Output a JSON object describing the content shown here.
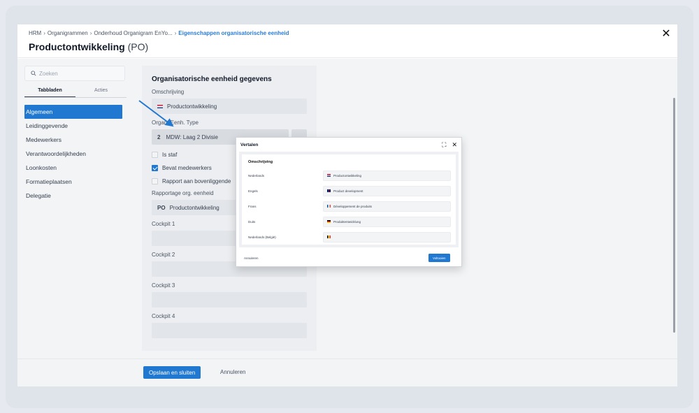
{
  "breadcrumb": {
    "items": [
      "HRM",
      "Organigrammen",
      "Onderhoud Organigram EnYo..."
    ],
    "separator": "›",
    "current": "Eigenschappen organisatorische eenheid"
  },
  "page": {
    "title": "Productontwikkeling",
    "code": "(PO)",
    "close_glyph": "✕"
  },
  "sidebar": {
    "search_placeholder": "Zoeken",
    "tabs": [
      {
        "label": "Tabbladen",
        "active": true
      },
      {
        "label": "Acties",
        "active": false
      }
    ],
    "items": [
      {
        "label": "Algemeen",
        "active": true
      },
      {
        "label": "Leidinggevende",
        "active": false
      },
      {
        "label": "Medewerkers",
        "active": false
      },
      {
        "label": "Verantwoordelijkheden",
        "active": false
      },
      {
        "label": "Loonkosten",
        "active": false
      },
      {
        "label": "Formatieplaatsen",
        "active": false
      },
      {
        "label": "Delegatie",
        "active": false
      }
    ]
  },
  "form": {
    "section_title": "Organisatorische eenheid gegevens",
    "omschrijving_label": "Omschrijving",
    "omschrijving_value": "Productontwikkeling",
    "type_label": "Organ. Eenh. Type",
    "type_code": "2",
    "type_value": "MDW: Laag 2 Divisie",
    "checks": [
      {
        "label": "Is staf",
        "checked": false
      },
      {
        "label": "Bevat medewerkers",
        "checked": true
      },
      {
        "label": "Rapport aan bovenliggende",
        "checked": false
      }
    ],
    "rapportage_label": "Rapportage org. eenheid",
    "rapportage_code": "PO",
    "rapportage_value": "Productontwikkeling",
    "cockpits": [
      "Cockpit 1",
      "Cockpit 2",
      "Cockpit 3",
      "Cockpit 4"
    ]
  },
  "footer": {
    "save_label": "Opslaan en sluiten",
    "cancel_label": "Annuleren"
  },
  "modal": {
    "title": "Vertalen",
    "expand_glyph": "⛶",
    "close_glyph": "✕",
    "section_title": "Omschrijving",
    "rows": [
      {
        "lang": "Nederlands",
        "flag": "nl",
        "value": "Productontwikkeling"
      },
      {
        "lang": "Engels",
        "flag": "gb",
        "value": "Product development"
      },
      {
        "lang": "Frans",
        "flag": "fr",
        "value": "Développement de produits"
      },
      {
        "lang": "Duits",
        "flag": "de",
        "value": "Produktentwicklung"
      },
      {
        "lang": "Nederlands (België)",
        "flag": "be",
        "value": ""
      }
    ],
    "cancel_label": "Annuleren",
    "ok_label": "Voltooien"
  },
  "colors": {
    "accent": "#2078d0",
    "breadcrumb_current": "#2b7cd3"
  }
}
